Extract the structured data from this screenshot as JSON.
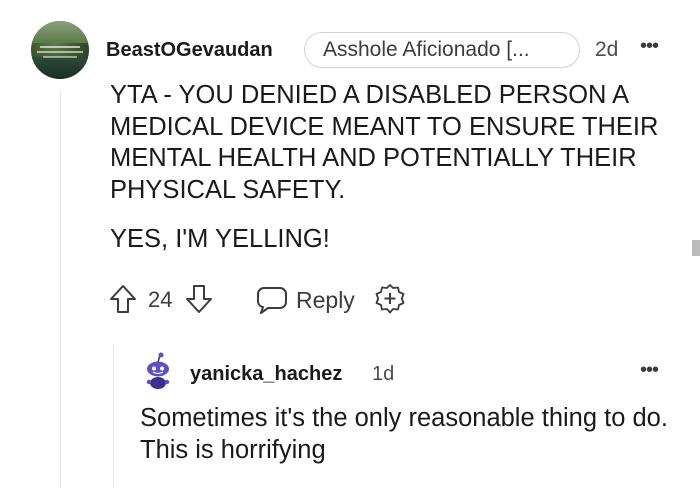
{
  "comment": {
    "username": "BeastOGevaudan",
    "flair": "Asshole Aficionado [...",
    "time": "2d",
    "more": "•••",
    "paragraphs": [
      "YTA - YOU DENIED A DISABLED PERSON A MEDICAL DEVICE MEANT TO ENSURE THEIR MENTAL HEALTH AND POTENTIALLY THEIR PHYSICAL SAFETY.",
      "YES, I'M YELLING!"
    ],
    "score": "24",
    "reply_label": "Reply",
    "icons": [
      "upvote-icon",
      "downvote-icon",
      "reply-bubble-icon",
      "award-plus-icon"
    ]
  },
  "reply": {
    "username": "yanicka_hachez",
    "time": "1d",
    "more": "•••",
    "text": "Sometimes it's the only reasonable thing to do. This is horrifying"
  },
  "colors": {
    "text": "#1a1a1b",
    "muted": "#3c3c3c",
    "border": "#d0d3d6",
    "avatar_purple": "#5e4fc7"
  }
}
